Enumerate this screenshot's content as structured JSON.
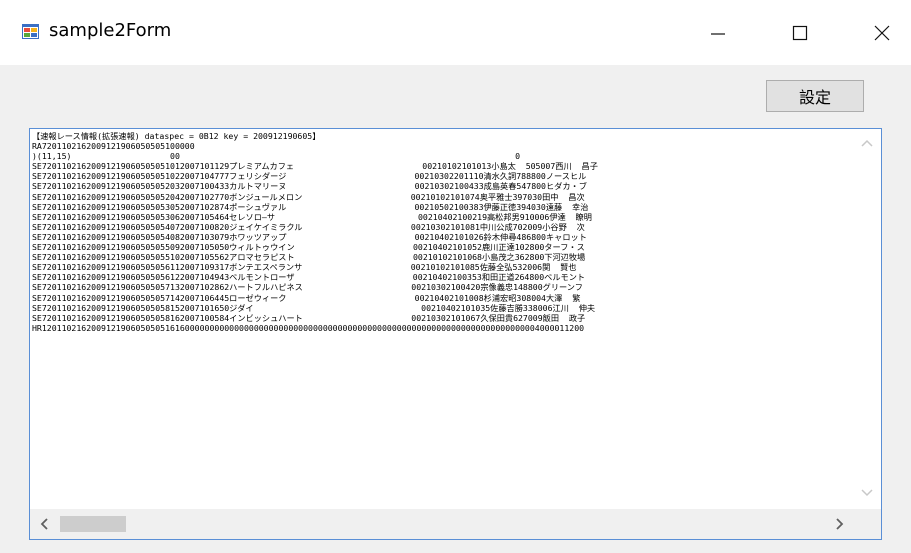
{
  "window": {
    "title": "sample2Form",
    "icon": "winforms-app-icon",
    "controls": [
      "minimize-icon",
      "maximize-icon",
      "close-icon"
    ]
  },
  "toolbar": {
    "settings_label": "設定"
  },
  "output": {
    "lines": [
      "【速報レース情報(拡張速報) dataspec = 0B12 key = 200912190605】",
      "RA7201102162009121906050505100000",
      ")(11,15)                    00                                                                    0",
      "SE7201102162009121906050505101200710112​9プレミアムカフェ                          00210102101013小島太  505007西川  昌子",
      "SE72011021620091219060505051022007104777フェリシダージ                          00210302201110清水久詞788800ノースヒル",
      "SE72011021620091219060505052032007100433カルトマリーヌ                          00210302100433成島英春547800ヒダカ・ブ",
      "SE72011021620091219060505052042007102770ボンジュールメロン                      00210102101074奥平雅士397030田中  昌次",
      "SE72011021620091219060505053052007102874ポーシュヴァル                          00210502100383伊藤正徳394030遠藤  幸治",
      "SE72011021620091219060505053062007105464セレソロ―サ                             00210402100219高松邦男910006伊達  瞭明",
      "SE72011021620091219060505054072007100820ジェイケイミラクル                      00210302101081中川公成702009小谷野  次",
      "SE72011021620091219060505054082007103079ホワッツアップ                          00210402101026鈴木伸尋486800キャロット",
      "SE72011021620091219060505055092007105050ウィルトゥウイン                        00210402101052鹿川正達102800ターフ・ス",
      "SE72011021620091219060505055102007105562アロマセラピスト                        00210102101068小島茂之362800下河辺牧場",
      "SE72011021620091219060505056112007109317ボンテエスペランサ                      00210102101085佐藤全弘532006関  賢也",
      "SE72011021620091219060505056122007104943ベルモントローザ                        00210402100353和田正道264800ベルモント",
      "SE72011021620091219060505057132007102862ハートフルハピネス                      00210302100420宗像義忠148800グリーンフ",
      "SE72011021620091219060505057142007106445ローゼウィーク                          00210402101008杉浦宏昭308004大澤  繁",
      "SE72011021620091219060505058152007101650ジダイ                                  00210402101035佐藤吉勝338006江川  伸夫",
      "SE72011021620091219060505058162007100584インビッシュハート                      00210302101067久保田貴627009飯田  政子",
      "HR12011021620091219060505051616000000000000000000000000000000000000000000000000000000000000000000000004000011200"
    ]
  }
}
